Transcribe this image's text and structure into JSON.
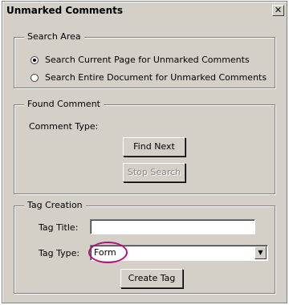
{
  "window": {
    "title": "Unmarked Comments",
    "close_glyph": "✕"
  },
  "search_area": {
    "legend": "Search Area",
    "options": [
      {
        "label": "Search Current Page for Unmarked Comments",
        "selected": true
      },
      {
        "label": "Search Entire Document for Unmarked Comments",
        "selected": false
      }
    ]
  },
  "found_comment": {
    "legend": "Found Comment",
    "comment_type_label": "Comment Type:",
    "find_next_label": "Find Next",
    "stop_search_label": "Stop Search"
  },
  "tag_creation": {
    "legend": "Tag Creation",
    "tag_title_label": "Tag Title:",
    "tag_title_value": "",
    "tag_type_label": "Tag Type:",
    "tag_type_value": "Form",
    "create_tag_label": "Create Tag"
  },
  "colors": {
    "dialog_bg": "#d4d0c8",
    "highlight": "#b0167a"
  },
  "icons": {
    "close": "close-icon",
    "dropdown": "chevron-down-icon"
  }
}
